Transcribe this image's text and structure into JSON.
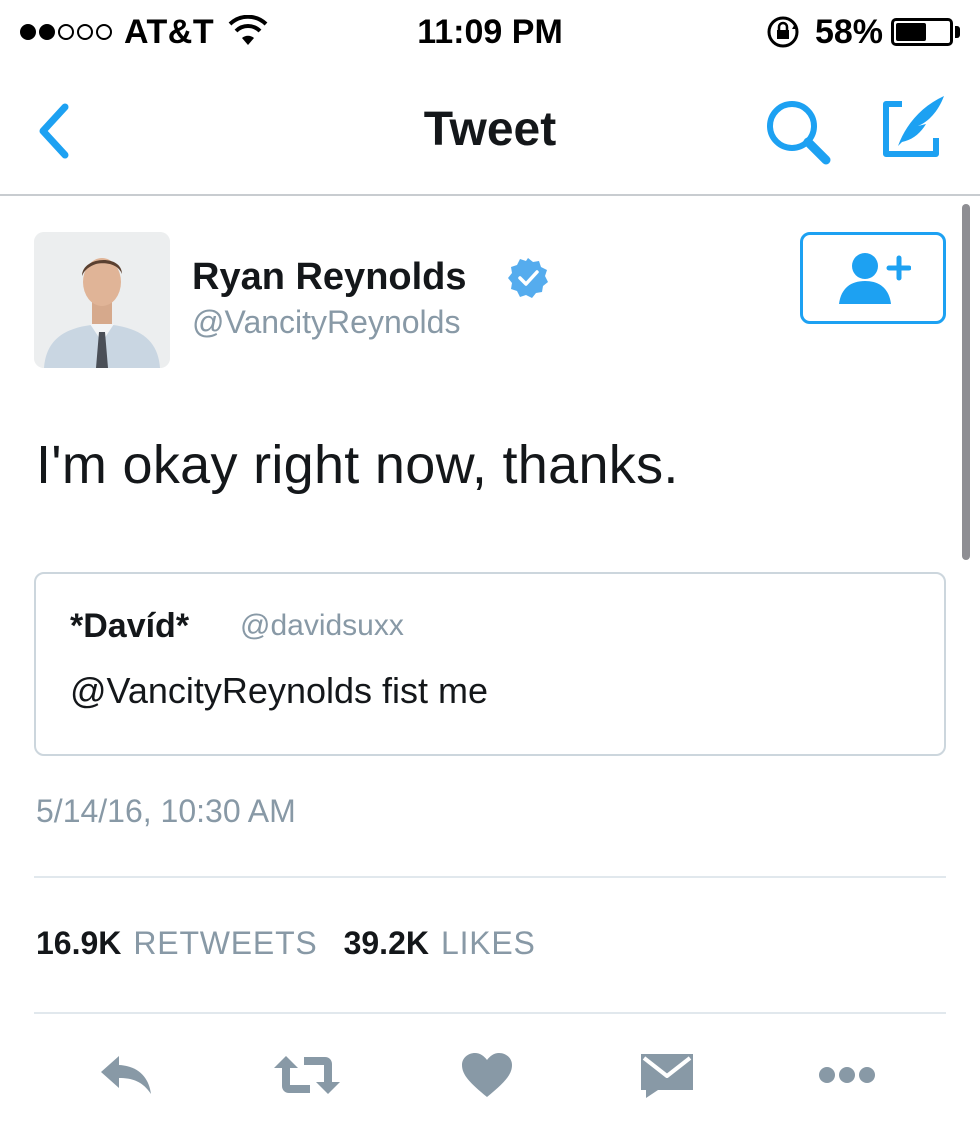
{
  "status_bar": {
    "carrier": "AT&T",
    "signal_bars_filled": 2,
    "signal_bars_total": 5,
    "time": "11:09 PM",
    "battery_percent": "58%",
    "battery_level": 0.58
  },
  "nav": {
    "title": "Tweet",
    "icons": [
      "chevron-left-icon",
      "search-icon",
      "compose-icon"
    ]
  },
  "tweet": {
    "author_name": "Ryan Reynolds",
    "author_handle": "@VancityReynolds",
    "verified": true,
    "text": "I'm okay right now, thanks.",
    "quote": {
      "name": "*Davíd*",
      "handle": "@davidsuxx",
      "text": "@VancityReynolds fist me"
    },
    "timestamp": "5/14/16, 10:30 AM",
    "retweets_count": "16.9K",
    "retweets_label": "RETWEETS",
    "likes_count": "39.2K",
    "likes_label": "LIKES"
  },
  "actions": [
    "reply-icon",
    "retweet-icon",
    "heart-icon",
    "envelope-icon",
    "more-icon"
  ],
  "colors": {
    "accent": "#1da1f2",
    "verified": "#55acee",
    "muted_text": "#8899a6",
    "action_icon": "#8899a6",
    "border": "#ccd6dd"
  }
}
